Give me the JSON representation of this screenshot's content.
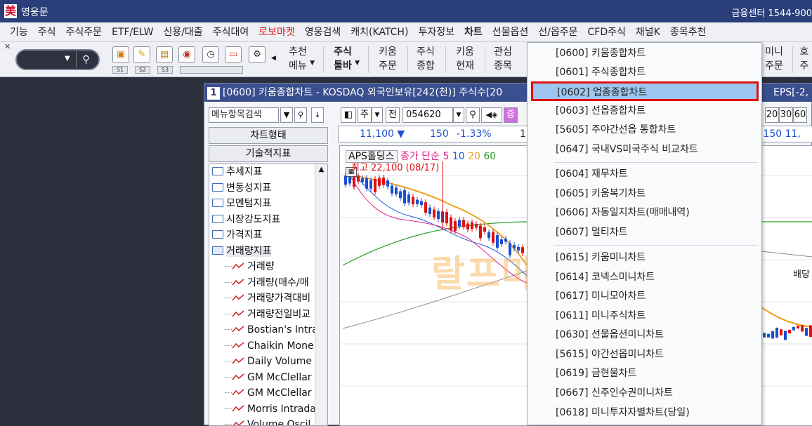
{
  "window": {
    "app_icon": "美",
    "title": "영웅문",
    "right_text": "금융센터 1544-900"
  },
  "menubar": [
    "기능",
    "주식",
    "주식주문",
    "ETF/ELW",
    "신용/대출",
    "주식대여",
    "로보마켓",
    "영웅검색",
    "캐치(KATCH)",
    "투자정보",
    "차트",
    "선물옵션",
    "선/옵주문",
    "CFD주식",
    "채널K",
    "종목추천"
  ],
  "toolbar": {
    "search": {
      "dd": "▼",
      "mag": "⚲"
    },
    "slots": [
      "S1",
      "S2",
      "S3"
    ],
    "buttons": [
      {
        "l1": "추천",
        "l2": "메뉴"
      },
      {
        "l1": "주식",
        "l2": "툴바"
      },
      {
        "l1": "키움",
        "l2": "주문"
      },
      {
        "l1": "주식",
        "l2": "종합"
      },
      {
        "l1": "키움",
        "l2": "현재"
      },
      {
        "l1": "관심",
        "l2": "종목"
      },
      {
        "l1": "미니",
        "l2": "주문"
      },
      {
        "l1": "호",
        "l2": "주"
      }
    ]
  },
  "chart_window": {
    "num": "1",
    "title": "[0600] 키움종합차트 - KOSDAQ 외국인보유[242(천)] 주식수[20",
    "title_right": "EPS[-2,"
  },
  "left_panel": {
    "search_placeholder": "메뉴항목검색",
    "tab1": "차트형태",
    "tab2": "기술적지표",
    "folders": [
      "추세지표",
      "변동성지표",
      "모멘텀지표",
      "시장강도지표",
      "가격지표",
      "거래량지표"
    ],
    "children": [
      "거래량",
      "거래량(매수/매",
      "거래량가격대비",
      "거래량전일비교",
      "Bostian's Intra",
      "Chaikin Mone",
      "Daily Volume",
      "GM McClellar",
      "GM McClellar",
      "Morris Intrada",
      "Volume Oscil"
    ]
  },
  "chart_toolbar": {
    "period": "주",
    "prev": "전",
    "code": "054620",
    "right_nums": [
      "20",
      "30",
      "60"
    ]
  },
  "price_row": {
    "price": "11,100 ▼",
    "change": "150",
    "pct": "-1.33%",
    "extra": "1(",
    "right": ",150  11,"
  },
  "chart_head": {
    "name": "APS홀딩스",
    "ma_label": "종가 단순",
    "ma": [
      "5",
      "10",
      "20",
      "60"
    ]
  },
  "chart_annotations": {
    "high": "최고 22,100 (08/17)",
    "dividend": "배당"
  },
  "watermark": "랄프마켓트",
  "dropdown": {
    "group1": [
      "[0600] 키움종합차트",
      "[0601] 주식종합차트",
      "[0602] 업종종합차트",
      "[0603] 선옵종합차트",
      "[5605] 주야간선옵 통합차트",
      "[0647] 국내VS미국주식 비교차트"
    ],
    "group2": [
      "[0604] 재무차트",
      "[0605] 키움복기차트",
      "[0606] 자동일지차트(매매내역)",
      "[0607] 멀티차트"
    ],
    "group3": [
      "[0615] 키움미니차트",
      "[0614] 코넥스미니차트",
      "[0617] 미니모아차트",
      "[0611] 미니주식차트",
      "[0630] 선물옵션미니차트",
      "[5615] 야간선옵미니차트",
      "[0619] 금현물차트",
      "[0667] 신주인수권미니차트",
      "[0618] 미니투자자별차트(당일)"
    ],
    "selected": "[0602] 업종종합차트"
  },
  "colors": {
    "titlebar": "#2a3f7a",
    "up": "#e01010",
    "down": "#1a4fd1",
    "ma5": "#e0208a",
    "ma10": "#1a5ad6",
    "ma20": "#f0a020",
    "ma60": "#2ea02e",
    "selection": "#9dc7f0"
  }
}
